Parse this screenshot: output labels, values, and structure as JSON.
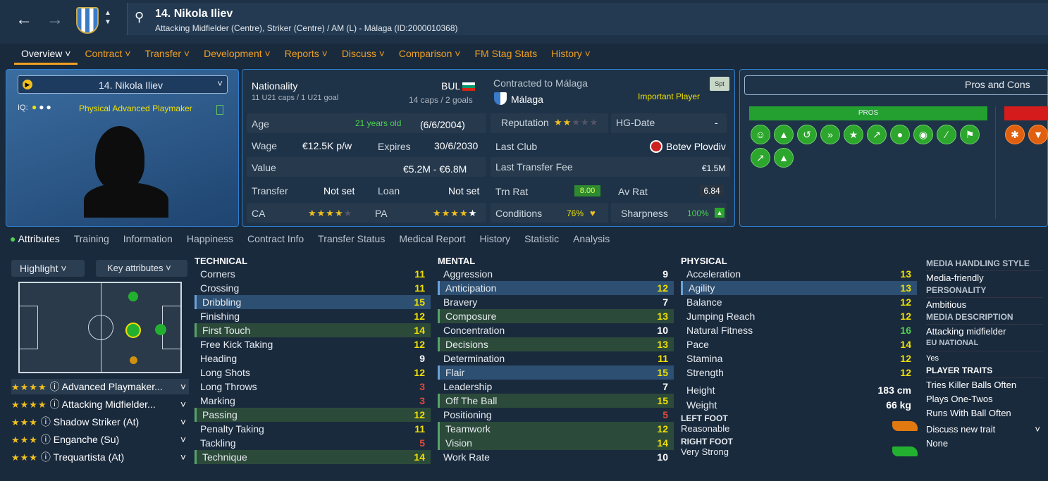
{
  "header": {
    "title": "14. Nikola Iliev",
    "subtitle": "Attacking Midfielder (Centre), Striker (Centre) / AM (L) - Málaga (ID:2000010368)"
  },
  "menu": [
    "Overview",
    "Contract",
    "Transfer",
    "Development",
    "Reports",
    "Discuss",
    "Comparison",
    "FM Stag Stats",
    "History"
  ],
  "portrait": {
    "name": "14. Nikola Iliev",
    "iq_label": "IQ:",
    "role": "Physical Advanced Playmaker"
  },
  "info": {
    "nationality_label": "Nationality",
    "nationality": "BUL",
    "u21": "11 U21 caps / 1 U21 goal",
    "caps": "14 caps / 2 goals",
    "age_label": "Age",
    "age": "21 years old",
    "dob": "(6/6/2004)",
    "wage_label": "Wage",
    "wage": "€12.5K p/w",
    "expires_label": "Expires",
    "expires": "30/6/2030",
    "value_label": "Value",
    "value": "€5.2M - €6.8M",
    "transfer_label": "Transfer",
    "transfer": "Not set",
    "loan_label": "Loan",
    "loan": "Not set",
    "ca_label": "CA",
    "pa_label": "PA",
    "contracted_label": "Contracted to Málaga",
    "club": "Málaga",
    "status": "Important Player",
    "spt": "Spt",
    "rep_label": "Reputation",
    "hg_label": "HG-Date",
    "hg": "-",
    "lastclub_label": "Last Club",
    "lastclub": "Botev Plovdiv",
    "fee_label": "Last Transfer Fee",
    "fee": "€1.5M",
    "trn_label": "Trn Rat",
    "trn": "8.00",
    "av_label": "Av Rat",
    "av": "6.84",
    "cond_label": "Conditions",
    "cond": "76%",
    "sharp_label": "Sharpness",
    "sharp": "100%"
  },
  "pros": {
    "title": "Pros and Cons",
    "pros_label": "PROS"
  },
  "tabs": [
    "Attributes",
    "Training",
    "Information",
    "Happiness",
    "Contract Info",
    "Transfer Status",
    "Medical Report",
    "History",
    "Statistic",
    "Analysis"
  ],
  "controls": {
    "highlight": "Highlight",
    "key": "Key attributes"
  },
  "roles": [
    "Advanced Playmaker...",
    "Attacking Midfielder...",
    "Shadow Striker (At)",
    "Enganche (Su)",
    "Trequartista (At)"
  ],
  "technical": {
    "title": "TECHNICAL",
    "items": [
      [
        "Corners",
        "11"
      ],
      [
        "Crossing",
        "11"
      ],
      [
        "Dribbling",
        "15"
      ],
      [
        "Finishing",
        "12"
      ],
      [
        "First Touch",
        "14"
      ],
      [
        "Free Kick Taking",
        "12"
      ],
      [
        "Heading",
        "9"
      ],
      [
        "Long Shots",
        "12"
      ],
      [
        "Long Throws",
        "3"
      ],
      [
        "Marking",
        "3"
      ],
      [
        "Passing",
        "12"
      ],
      [
        "Penalty Taking",
        "11"
      ],
      [
        "Tackling",
        "5"
      ],
      [
        "Technique",
        "14"
      ]
    ]
  },
  "mental": {
    "title": "MENTAL",
    "items": [
      [
        "Aggression",
        "9"
      ],
      [
        "Anticipation",
        "12"
      ],
      [
        "Bravery",
        "7"
      ],
      [
        "Composure",
        "13"
      ],
      [
        "Concentration",
        "10"
      ],
      [
        "Decisions",
        "13"
      ],
      [
        "Determination",
        "11"
      ],
      [
        "Flair",
        "15"
      ],
      [
        "Leadership",
        "7"
      ],
      [
        "Off The Ball",
        "15"
      ],
      [
        "Positioning",
        "5"
      ],
      [
        "Teamwork",
        "12"
      ],
      [
        "Vision",
        "14"
      ],
      [
        "Work Rate",
        "10"
      ]
    ]
  },
  "physical": {
    "title": "PHYSICAL",
    "items": [
      [
        "Acceleration",
        "13"
      ],
      [
        "Agility",
        "13"
      ],
      [
        "Balance",
        "12"
      ],
      [
        "Jumping Reach",
        "12"
      ],
      [
        "Natural Fitness",
        "16"
      ],
      [
        "Pace",
        "14"
      ],
      [
        "Stamina",
        "12"
      ],
      [
        "Strength",
        "12"
      ]
    ],
    "height_label": "Height",
    "height": "183 cm",
    "weight_label": "Weight",
    "weight": "66 kg",
    "lf_label": "LEFT FOOT",
    "lf": "Reasonable",
    "rf_label": "RIGHT FOOT",
    "rf": "Very Strong"
  },
  "side": {
    "mhs_label": "MEDIA HANDLING STYLE",
    "mhs": "Media-friendly",
    "pers_label": "PERSONALITY",
    "pers": "Ambitious",
    "md_label": "MEDIA DESCRIPTION",
    "md": "Attacking midfielder",
    "eu_label": "EU NATIONAL",
    "eu": "Yes",
    "traits_label": "PLAYER TRAITS",
    "traits": [
      "Tries Killer Balls Often",
      "Plays One-Twos",
      "Runs With Ball Often"
    ],
    "discuss": "Discuss new trait",
    "none": "None"
  }
}
